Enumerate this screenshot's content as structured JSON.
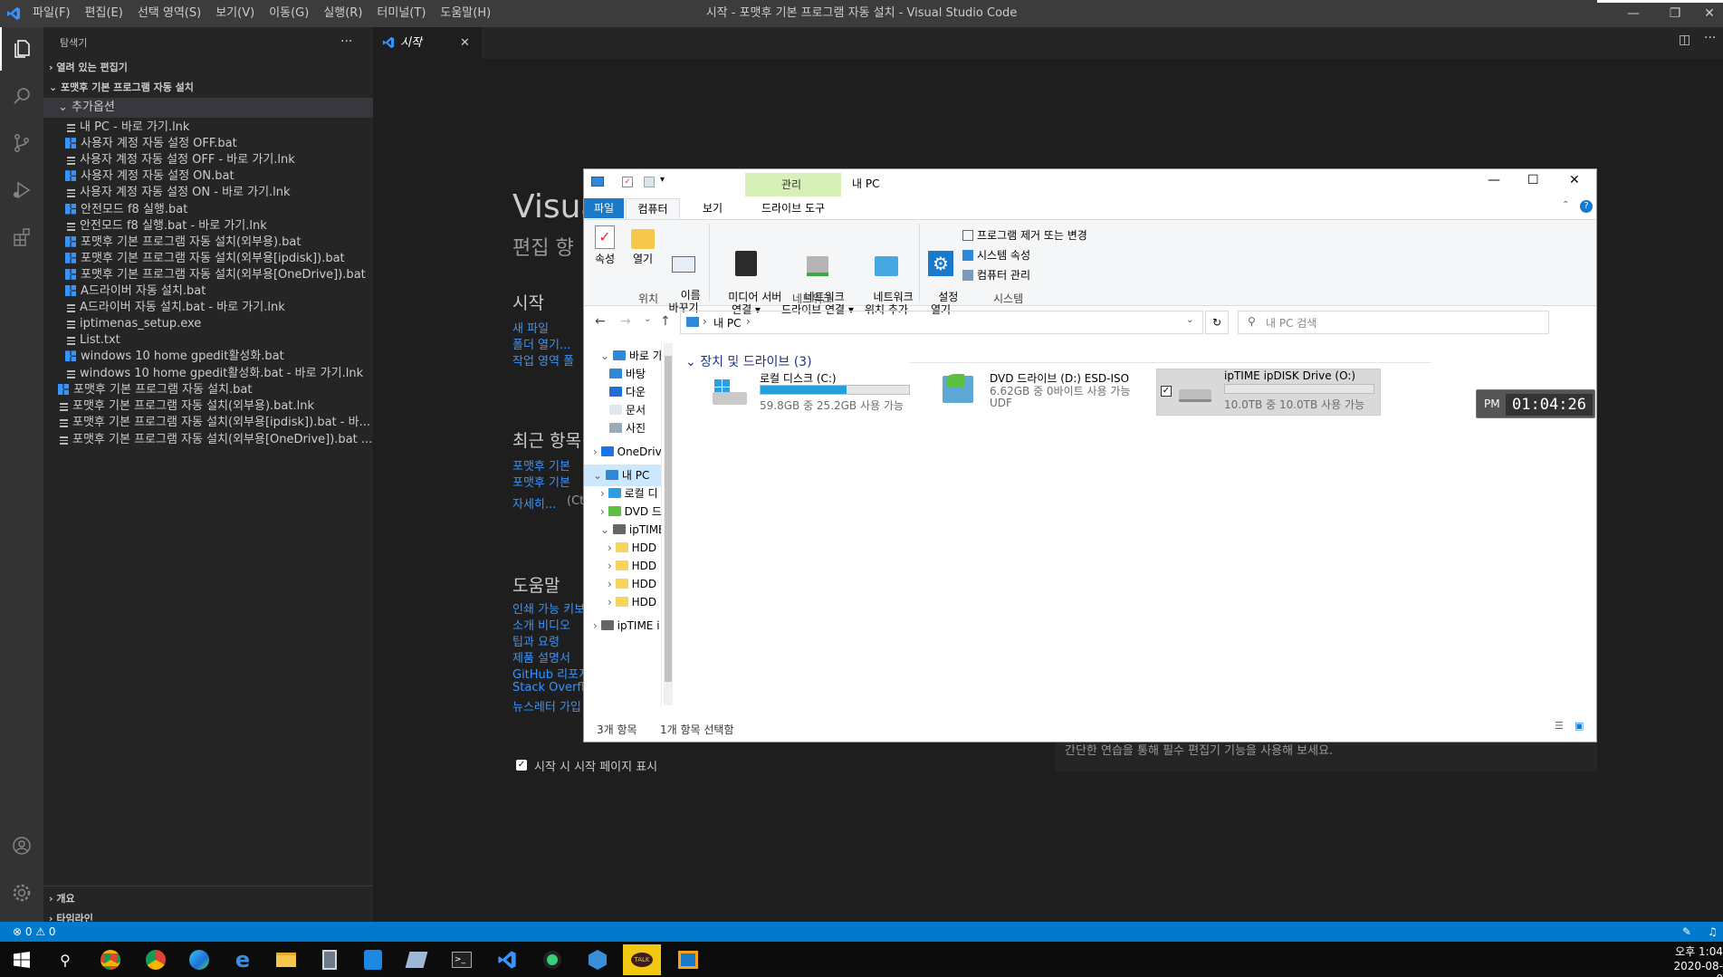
{
  "titlebar": {
    "menu": [
      "파일(F)",
      "편집(E)",
      "선택 영역(S)",
      "보기(V)",
      "이동(G)",
      "실행(R)",
      "터미널(T)",
      "도움말(H)"
    ],
    "title": "시작 - 포맷후 기본 프로그램 자동 설치 - Visual Studio Code"
  },
  "sidebar": {
    "title": "탐색기",
    "more": "···",
    "open_editors": "열려 있는 편집기",
    "folder": "포맷후 기본 프로그램 자동 설치",
    "subfolder": "추가옵션",
    "items": [
      {
        "label": "내 PC - 바로 가기.lnk",
        "type": "file"
      },
      {
        "label": "사용자 계정 자동 설정 OFF.bat",
        "type": "win"
      },
      {
        "label": "사용자 계정 자동 설정 OFF - 바로 가기.lnk",
        "type": "file"
      },
      {
        "label": "사용자 계정 자동 설정 ON.bat",
        "type": "win"
      },
      {
        "label": "사용자 계정 자동 설정 ON - 바로 가기.lnk",
        "type": "file"
      },
      {
        "label": "안전모드 f8 실행.bat",
        "type": "win"
      },
      {
        "label": "안전모드 f8 실행.bat - 바로 가기.lnk",
        "type": "file"
      },
      {
        "label": "포맷후 기본 프로그램 자동 설치(외부용).bat",
        "type": "win"
      },
      {
        "label": "포맷후 기본 프로그램 자동 설치(외부용[ipdisk]).bat",
        "type": "win"
      },
      {
        "label": "포맷후 기본 프로그램 자동 설치(외부용[OneDrive]).bat",
        "type": "win"
      },
      {
        "label": "A드라이버 자동 설치.bat",
        "type": "win"
      },
      {
        "label": "A드라이버 자동 설치.bat - 바로 가기.lnk",
        "type": "file"
      },
      {
        "label": "iptimenas_setup.exe",
        "type": "file"
      },
      {
        "label": "List.txt",
        "type": "file"
      },
      {
        "label": "windows 10 home gpedit활성화.bat",
        "type": "win"
      },
      {
        "label": "windows 10 home gpedit활성화.bat - 바로 가기.lnk",
        "type": "file"
      }
    ],
    "root_items": [
      {
        "label": "포맷후 기본 프로그램 자동 설치.bat",
        "type": "win"
      },
      {
        "label": "포맷후 기본 프로그램 자동 설치(외부용).bat.lnk",
        "type": "file"
      },
      {
        "label": "포맷후 기본 프로그램 자동 설치(외부용[ipdisk]).bat - 바...",
        "type": "file"
      },
      {
        "label": "포맷후 기본 프로그램 자동 설치(외부용[OneDrive]).bat ...",
        "type": "file"
      }
    ],
    "outline": "개요",
    "timeline": "타임라인"
  },
  "editor": {
    "tab_label": "시작",
    "welcome_title": "Visua",
    "welcome_sub": "편집 향",
    "start_heading": "시작",
    "start_links": [
      "새 파일",
      "폴더 열기...",
      "작업 영역 폴"
    ],
    "recent_heading": "최근 항목",
    "recent_links": [
      "포맷후 기본",
      "포맷후 기본"
    ],
    "more_link": "자세히...",
    "more_hint": "(Ct",
    "help_heading": "도움말",
    "help_links": [
      "인쇄 가능 키보",
      "소개 비디오",
      "팁과 요령",
      "제품 설명서",
      "GitHub 리포지",
      "Stack Overflo",
      "뉴스레터 가입"
    ],
    "show_on_start": "시작 시 시작 페이지 표시",
    "tip_text": "간단한 연습을 통해 필수 편집기 기능을 사용해 보세요."
  },
  "explorer": {
    "title": "내 PC",
    "manage_tab": "관리",
    "tabs": [
      "파일",
      "컴퓨터",
      "보기",
      "드라이브 도구"
    ],
    "ribbon": {
      "properties": "속성",
      "open": "열기",
      "rename": "이름\n바꾸기",
      "group_location": "위치",
      "media_server": "미디어 서버\n연결 ▾",
      "map_drive": "네트워크\n드라이브 연결 ▾",
      "add_network": "네트워크\n위치 추가",
      "group_network": "네트워크",
      "settings": "설정\n열기",
      "uninstall": "프로그램 제거 또는 변경",
      "sys_props": "시스템 속성",
      "manage": "컴퓨터 관리",
      "group_system": "시스템"
    },
    "address": "내 PC",
    "address_sep": "›",
    "search_placeholder": "내 PC 검색",
    "nav": [
      "바로 가",
      "바탕",
      "다운",
      "문서",
      "사진",
      "OneDriv",
      "내 PC",
      "로컬 디",
      "DVD 드",
      "ipTIME",
      "HDD",
      "HDD",
      "HDD",
      "HDD",
      "ipTIME i"
    ],
    "section": "장치 및 드라이브 (3)",
    "drives": [
      {
        "name": "로컬 디스크 (C:)",
        "info": "59.8GB 중 25.2GB 사용 가능",
        "fill": 0.58
      },
      {
        "name": "DVD 드라이브 (D:) ESD-ISO",
        "info": "6.62GB 중 0바이트 사용 가능",
        "extra": "UDF"
      },
      {
        "name": "ipTIME ipDISK Drive (O:)",
        "info": "10.0TB 중 10.0TB 사용 가능",
        "fill": 0.0
      }
    ],
    "status_count": "3개 항목",
    "status_selected": "1개 항목 선택함"
  },
  "clock": {
    "ampm": "PM",
    "time": "01:04:26"
  },
  "statusbar": {
    "errors": "⊗ 0 ⚠ 0"
  },
  "taskbar": {
    "time": "오후 1:04",
    "date": "2020-08-0"
  }
}
